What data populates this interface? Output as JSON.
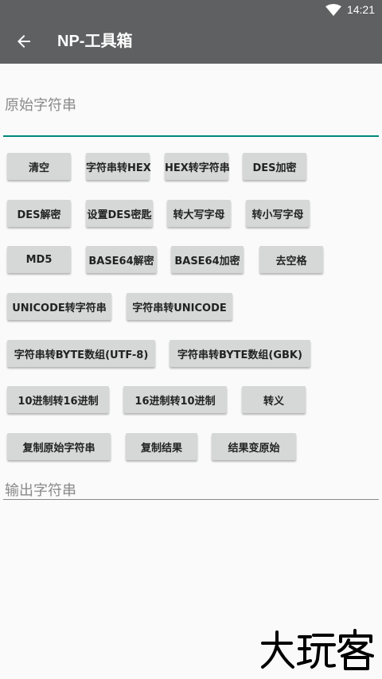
{
  "status": {
    "time": "14:21",
    "wifi_icon": "wifi-icon"
  },
  "appbar": {
    "title": "NP-工具箱",
    "back_icon": "arrow-left-icon"
  },
  "input": {
    "label": "原始字符串",
    "value": ""
  },
  "buttons": {
    "clear": "清空",
    "str_to_hex": "字符串转HEX",
    "hex_to_str": "HEX转字符串",
    "des_encrypt": "DES加密",
    "des_decrypt": "DES解密",
    "set_des_key": "设置DES密匙",
    "to_upper": "转大写字母",
    "to_lower": "转小写字母",
    "md5": "MD5",
    "base64_decode": "BASE64解密",
    "base64_encode": "BASE64加密",
    "remove_spaces": "去空格",
    "unicode_to_str": "UNICODE转字符串",
    "str_to_unicode": "字符串转UNICODE",
    "str_to_bytes_utf8": "字符串转BYTE数组(UTF-8)",
    "str_to_bytes_gbk": "字符串转BYTE数组(GBK)",
    "dec_to_hex": "10进制转16进制",
    "hex_to_dec": "16进制转10进制",
    "escape": "转义",
    "copy_original": "复制原始字符串",
    "copy_result": "复制结果",
    "result_to_original": "结果变原始"
  },
  "output": {
    "label": "输出字符串",
    "value": ""
  },
  "watermark": {
    "text": "大玩客"
  },
  "colors": {
    "appbar": "#5f6061",
    "accent": "#00897b",
    "button": "#d6d7d7"
  }
}
